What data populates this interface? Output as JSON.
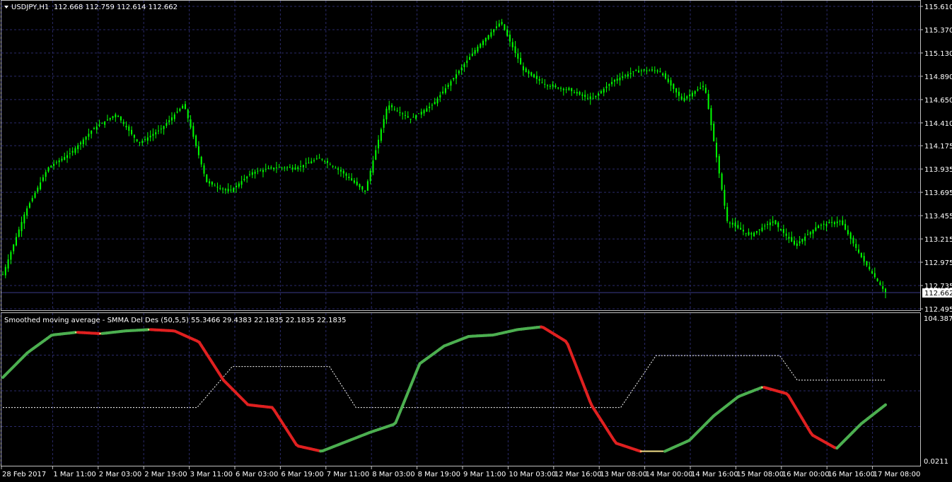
{
  "main_panel": {
    "header": {
      "symbol": "USDJPY,H1",
      "ohlc": "112.668 112.759 112.614 112.662"
    },
    "price_scale": [
      "115.610",
      "115.370",
      "115.130",
      "114.890",
      "114.650",
      "114.410",
      "114.175",
      "113.935",
      "113.695",
      "113.455",
      "113.215",
      "112.975",
      "112.735",
      "112.495"
    ],
    "current_price": "112.662"
  },
  "indicator_panel": {
    "header": "Smoothed moving average - SMMA Del Des (50,5,5) 55.3466 29.4383 22.1835 22.1835 22.1835",
    "scale_top": "104.3874",
    "scale_bottom": "0.0211"
  },
  "time_axis": [
    "28 Feb 2017",
    "1 Mar 11:00",
    "2 Mar 03:00",
    "2 Mar 19:00",
    "3 Mar 11:00",
    "6 Mar 03:00",
    "6 Mar 19:00",
    "7 Mar 11:00",
    "8 Mar 03:00",
    "8 Mar 19:00",
    "9 Mar 11:00",
    "10 Mar 03:00",
    "12 Mar 16:00",
    "13 Mar 08:00",
    "14 Mar 00:00",
    "14 Mar 16:00",
    "15 Mar 08:00",
    "16 Mar 00:00",
    "16 Mar 16:00",
    "17 Mar 08:00"
  ],
  "colors": {
    "background": "#000000",
    "grid": "#2a2a6a",
    "candle": "#00ff00",
    "rising": "#4caf50",
    "flat": "#f5e08a",
    "falling": "#e02020",
    "signal": "#ffffff"
  },
  "chart_data": [
    {
      "type": "line",
      "title": "USDJPY,H1",
      "x": [
        "28 Feb 2017",
        "1 Mar 03:00",
        "1 Mar 11:00",
        "1 Mar 19:00",
        "2 Mar 03:00",
        "2 Mar 11:00",
        "2 Mar 19:00",
        "3 Mar 03:00",
        "3 Mar 11:00",
        "3 Mar 19:00",
        "6 Mar 03:00",
        "6 Mar 11:00",
        "6 Mar 19:00",
        "7 Mar 03:00",
        "7 Mar 11:00",
        "7 Mar 19:00",
        "8 Mar 03:00",
        "8 Mar 11:00",
        "8 Mar 19:00",
        "9 Mar 03:00",
        "9 Mar 11:00",
        "9 Mar 19:00",
        "10 Mar 03:00",
        "10 Mar 11:00",
        "12 Mar 16:00",
        "13 Mar 00:00",
        "13 Mar 08:00",
        "13 Mar 16:00",
        "14 Mar 00:00",
        "14 Mar 08:00",
        "14 Mar 16:00",
        "15 Mar 00:00",
        "15 Mar 08:00",
        "15 Mar 16:00",
        "16 Mar 00:00",
        "16 Mar 08:00",
        "16 Mar 16:00",
        "17 Mar 00:00",
        "17 Mar 08:00",
        "17 Mar 12:00"
      ],
      "values": [
        112.85,
        113.5,
        113.95,
        114.1,
        114.35,
        114.5,
        114.2,
        114.35,
        114.6,
        113.8,
        113.7,
        113.9,
        113.95,
        113.95,
        114.05,
        113.9,
        113.7,
        114.6,
        114.45,
        114.6,
        114.9,
        115.2,
        115.45,
        114.95,
        114.8,
        114.75,
        114.65,
        114.85,
        114.95,
        114.95,
        114.65,
        114.8,
        113.4,
        113.25,
        113.4,
        113.15,
        113.35,
        113.4,
        113.0,
        112.66
      ],
      "ylim": [
        112.495,
        115.61
      ],
      "grid": true
    },
    {
      "type": "line",
      "title": "Smoothed moving average - SMMA Del Des (50,5,5) 55.3466 29.4383 22.1835 22.1835 22.1835",
      "x_positions": [
        0.0,
        0.02,
        0.05,
        0.08,
        0.1,
        0.12,
        0.14,
        0.16,
        0.18,
        0.2,
        0.22,
        0.26,
        0.3,
        0.33,
        0.37,
        0.4,
        0.43,
        0.46,
        0.5,
        0.54,
        0.58,
        0.62,
        0.66,
        0.7,
        0.74,
        0.77,
        0.8,
        0.82,
        0.84,
        0.86,
        0.88,
        0.9,
        0.92,
        0.94,
        0.96,
        0.98,
        1.0
      ],
      "series": [
        {
          "values": [
            62,
            80,
            93,
            95,
            94,
            96,
            97,
            96,
            88,
            60,
            42,
            40,
            12,
            8,
            15,
            22,
            28,
            72,
            85,
            92,
            93,
            97,
            99,
            88,
            42,
            14,
            8,
            8,
            16,
            34,
            48,
            55,
            50,
            20,
            10,
            28,
            42
          ]
        },
        {
          "values": [
            40,
            40,
            40,
            40,
            40,
            40,
            40,
            40,
            40,
            40,
            40,
            70,
            70,
            70,
            70,
            40,
            40,
            40,
            40,
            40,
            40,
            40,
            40,
            40,
            78,
            78,
            78,
            78,
            78,
            78,
            78,
            60,
            60,
            60,
            60,
            60,
            60
          ]
        }
      ],
      "ylim": [
        0.0211,
        104.3874
      ],
      "grid": true
    }
  ]
}
